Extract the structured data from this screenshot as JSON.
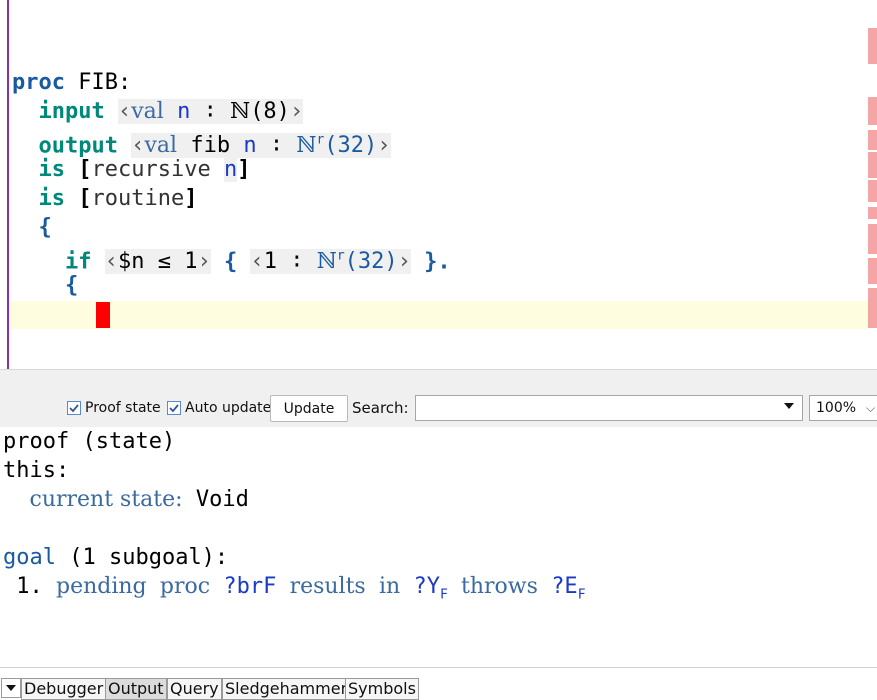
{
  "editor": {
    "line1": {
      "kw": "proc",
      "name": "FIB:"
    },
    "line2": {
      "kw": "input",
      "lt": "‹",
      "val": "val",
      "var": "n",
      "colon": "∶",
      "type": "ℕ",
      "arg": "(8)",
      "gt": "›"
    },
    "line3": {
      "kw": "output",
      "lt": "‹",
      "val": "val",
      "fib": "fib",
      "var": "n",
      "colon": "∶",
      "type": "ℕ",
      "sup": "r",
      "arg": "(32)",
      "gt": "›"
    },
    "line4": {
      "kw": "is",
      "open": "[",
      "word": "recursive",
      "var": "n",
      "close": "]"
    },
    "line5": {
      "kw": "is",
      "open": "[",
      "word": "routine",
      "close": "]"
    },
    "line6": {
      "brace": "{"
    },
    "line7": {
      "kw": "if",
      "lt": "‹",
      "cond": "$n ≤ 1",
      "gt": "›",
      "brace_open": "{",
      "lt2": "‹",
      "one": "1",
      "colon": "∶",
      "type": "ℕ",
      "sup": "r",
      "arg": "(32)",
      "gt2": "›",
      "brace_close": "}."
    },
    "line8": {
      "brace": "{"
    }
  },
  "toolbar": {
    "proof_state_label": "Proof state",
    "auto_update_label": "Auto update",
    "update_label": "Update",
    "search_label": "Search:",
    "search_value": "",
    "zoom_value": "100%"
  },
  "output": {
    "line1": "proof (state)",
    "line2": "this:",
    "line3": {
      "label": "current state:",
      "value": "Void"
    },
    "line5": {
      "kw": "goal",
      "rest": "(1 subgoal):"
    },
    "line6": {
      "num": "1.",
      "w1": "pending",
      "w2": "proc",
      "v1": "?brF",
      "w3": "results",
      "w4": "in",
      "v2": "?Y",
      "sub2": "F",
      "w5": "throws",
      "v3": "?E",
      "sub3": "F"
    }
  },
  "tabs": [
    "Debugger",
    "Output",
    "Query",
    "Sledgehammer",
    "Symbols"
  ],
  "colors": {
    "accent": "#1a5aa0",
    "keyword": "#00887a",
    "cursor": "#ff0000",
    "highlight_line": "#fffde0",
    "error_mark": "#f4a6a6"
  }
}
